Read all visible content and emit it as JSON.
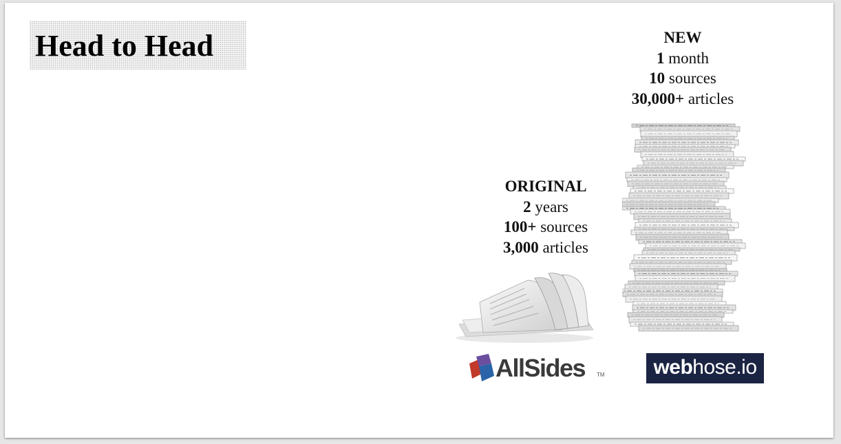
{
  "slide": {
    "title": "Head to Head"
  },
  "new": {
    "heading": "NEW",
    "duration_value": "1",
    "duration_unit": " month",
    "sources_value": "10",
    "sources_unit": " sources",
    "articles_value": "30,000+",
    "articles_unit": " articles"
  },
  "original": {
    "heading": "ORIGINAL",
    "duration_value": "2",
    "duration_unit": " years",
    "sources_value": "100+",
    "sources_unit": " sources",
    "articles_value": "3,000",
    "articles_unit": " articles"
  },
  "logos": {
    "allsides": "AllSides",
    "allsides_tm": "TM",
    "webhose_bold": "web",
    "webhose_rest": "hose.io"
  },
  "colors": {
    "webhose_bg": "#1b2443",
    "allsides_red": "#c0392b",
    "allsides_purple": "#6b4f9e",
    "allsides_blue": "#2a63a8"
  },
  "icons": {
    "small_pile": "newspaper-pile-icon",
    "tall_pile": "newspaper-stack-icon"
  }
}
